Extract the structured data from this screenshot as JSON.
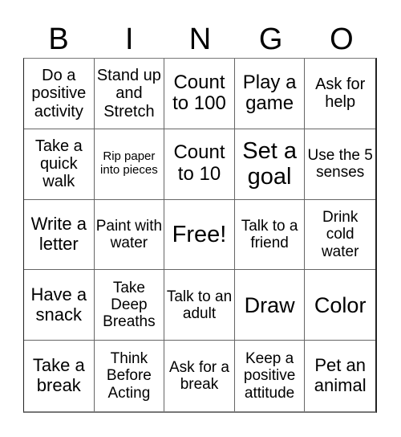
{
  "header": [
    "B",
    "I",
    "N",
    "G",
    "O"
  ],
  "cells": [
    "Do a positive activity",
    "Stand up and Stretch",
    "Count to 100",
    "Play a game",
    "Ask for help",
    "Take a quick walk",
    "Rip paper into pieces",
    "Count to 10",
    "Set a goal",
    "Use the 5 senses",
    "Write a letter",
    "Paint with water",
    "Free!",
    "Talk to a friend",
    "Drink cold water",
    "Have a snack",
    "Take Deep Breaths",
    "Talk to an adult",
    "Draw",
    "Color",
    "Take a break",
    "Think Before Acting",
    "Ask for a break",
    "Keep a positive attitude",
    "Pet an animal"
  ]
}
